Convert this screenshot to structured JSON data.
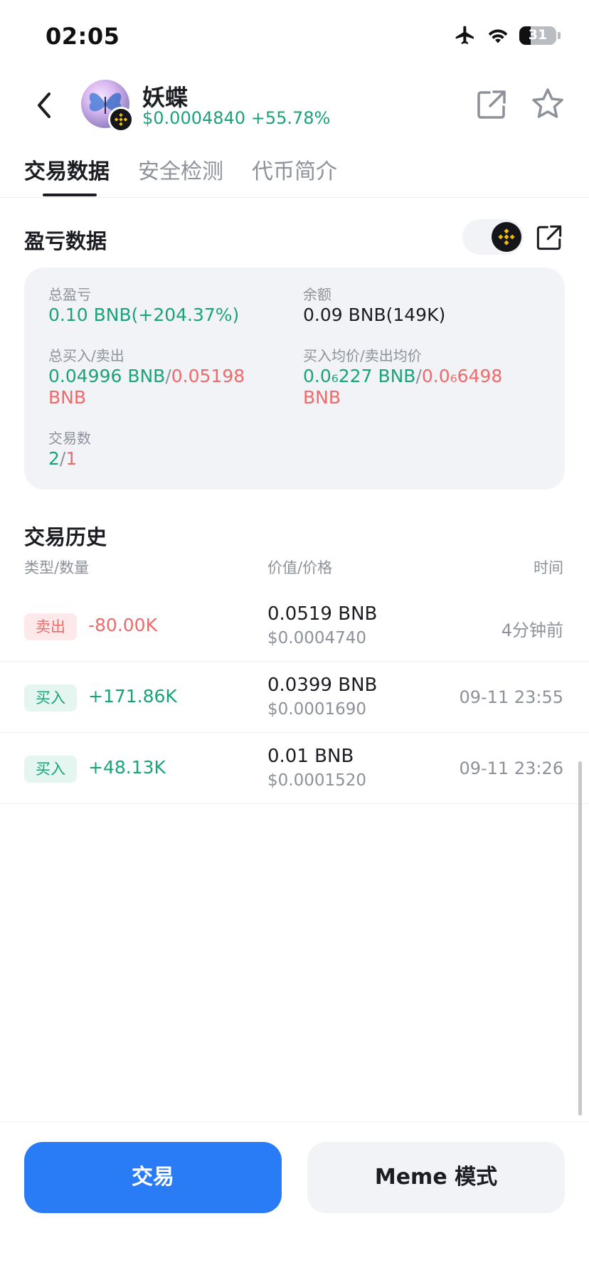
{
  "status_bar": {
    "time": "02:05",
    "battery": "31"
  },
  "header": {
    "token_name": "妖蝶",
    "price": "$0.0004840",
    "change": "+55.78%"
  },
  "tabs": [
    {
      "label": "交易数据",
      "active": true
    },
    {
      "label": "安全检测",
      "active": false
    },
    {
      "label": "代币简介",
      "active": false
    }
  ],
  "pnl": {
    "title": "盈亏数据",
    "total_pnl_label": "总盈亏",
    "total_pnl_value": "0.10 BNB(+204.37%)",
    "balance_label": "余额",
    "balance_value": "0.09 BNB(149K)",
    "buy_sell_label": "总买入/卖出",
    "total_buy": "0.04996 BNB",
    "sep": "/",
    "total_sell_line1": "0.05198",
    "total_sell_line2": "BNB",
    "avg_label": "买入均价/卖出均价",
    "avg_buy": "0.0₆227 BNB",
    "avg_sell_line1": "0.0₆6498",
    "avg_sell_line2": "BNB",
    "trades_label": "交易数",
    "trades_buy": "2",
    "trades_sell": "1"
  },
  "history": {
    "title": "交易历史",
    "col_type": "类型/数量",
    "col_value": "价值/价格",
    "col_time": "时间",
    "rows": [
      {
        "type": "卖出",
        "amount": "-80.00K",
        "value": "0.0519 BNB",
        "price": "$0.0004740",
        "time": "4分钟前"
      },
      {
        "type": "买入",
        "amount": "+171.86K",
        "value": "0.0399 BNB",
        "price": "$0.0001690",
        "time": "09-11 23:55"
      },
      {
        "type": "买入",
        "amount": "+48.13K",
        "value": "0.01 BNB",
        "price": "$0.0001520",
        "time": "09-11 23:26"
      }
    ]
  },
  "bottom": {
    "trade_label": "交易",
    "meme_label": "Meme 模式"
  },
  "colors": {
    "green": "#1aa37a",
    "red": "#ef6a6a",
    "blue": "#2a7cf6",
    "bnb": "#f0b90b"
  }
}
